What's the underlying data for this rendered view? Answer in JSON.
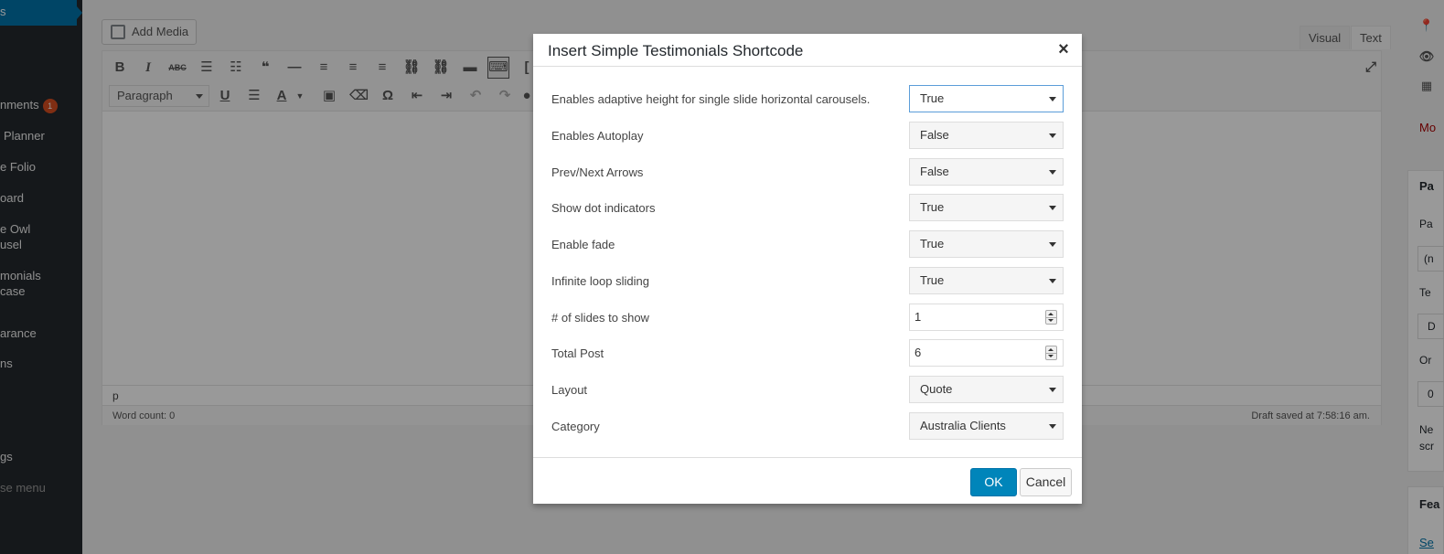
{
  "sidebar": {
    "active_label": "s",
    "items": [
      {
        "label": "nments",
        "badge": "1"
      },
      {
        "label": "Planner"
      },
      {
        "label": "e Folio"
      },
      {
        "label": "oard"
      },
      {
        "label": "e Owl",
        "label2": "usel"
      },
      {
        "label": "monials",
        "label2": "case"
      },
      {
        "label": "arance"
      },
      {
        "label": "ns"
      },
      {
        "label": "gs"
      },
      {
        "label": "se menu"
      }
    ]
  },
  "editor": {
    "add_media_label": "Add Media",
    "tab_visual": "Visual",
    "tab_text": "Text",
    "format_select": "Paragraph",
    "status_path": "p",
    "word_count": "Word count: 0",
    "draft_saved": "Draft saved at 7:58:16 am."
  },
  "right_col": {
    "link_text": "Mo",
    "box1_title": "Pa",
    "box1_label1": "Pa",
    "box1_value1": "(n",
    "box1_label2": "Te",
    "box1_value2": "D",
    "box1_label3": "Or",
    "box1_value3": "0",
    "box1_note1": "Ne",
    "box1_note2": "scr",
    "box2_title": "Fea",
    "box2_link": "Se"
  },
  "modal": {
    "title": "Insert Simple Testimonials Shortcode",
    "close_label": "×",
    "rows": [
      {
        "label": "Enables adaptive height for single slide horizontal carousels.",
        "value": "True"
      },
      {
        "label": "Enables Autoplay",
        "value": "False"
      },
      {
        "label": "Prev/Next Arrows",
        "value": "False"
      },
      {
        "label": "Show dot indicators",
        "value": "True"
      },
      {
        "label": "Enable fade",
        "value": "True"
      },
      {
        "label": "Infinite loop sliding",
        "value": "True"
      },
      {
        "label": "# of slides to show",
        "value": "1"
      },
      {
        "label": "Total Post",
        "value": "6"
      },
      {
        "label": "Layout",
        "value": "Quote"
      },
      {
        "label": "Category",
        "value": "Australia Clients"
      }
    ],
    "ok_label": "OK",
    "cancel_label": "Cancel"
  },
  "colors": {
    "sidebar_bg": "#23282d",
    "accent": "#0073aa",
    "button_primary": "#0085ba",
    "badge": "#d54e21"
  }
}
